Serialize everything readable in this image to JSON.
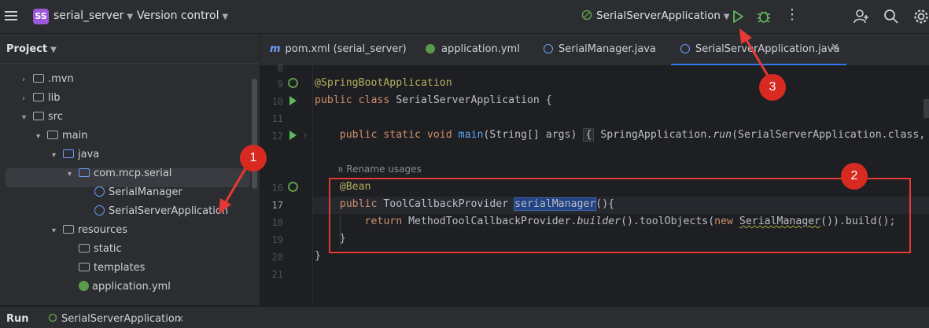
{
  "titlebar": {
    "project_badge": "SS",
    "project_name": "serial_server",
    "version_control": "Version control",
    "run_configuration": "SerialServerApplication",
    "more": "⋮"
  },
  "project_panel": {
    "title": "Project",
    "tree": [
      {
        "label": ".mvn",
        "kind": "folder",
        "depth": 1,
        "expanded": false
      },
      {
        "label": "lib",
        "kind": "folder",
        "depth": 1,
        "expanded": false
      },
      {
        "label": "src",
        "kind": "folder",
        "depth": 1,
        "expanded": true
      },
      {
        "label": "main",
        "kind": "folder",
        "depth": 2,
        "expanded": true
      },
      {
        "label": "java",
        "kind": "source-folder",
        "depth": 3,
        "expanded": true
      },
      {
        "label": "com.mcp.serial",
        "kind": "package",
        "depth": 4,
        "expanded": true
      },
      {
        "label": "SerialManager",
        "kind": "class",
        "depth": 5
      },
      {
        "label": "SerialServerApplication",
        "kind": "spring-class",
        "depth": 5,
        "selected": true
      },
      {
        "label": "resources",
        "kind": "resources-folder",
        "depth": 3,
        "expanded": true
      },
      {
        "label": "static",
        "kind": "folder",
        "depth": 4
      },
      {
        "label": "templates",
        "kind": "folder",
        "depth": 4
      },
      {
        "label": "application.yml",
        "kind": "yml",
        "depth": 4
      }
    ]
  },
  "tabs": [
    {
      "label": "pom.xml (serial_server)",
      "icon": "maven-icon"
    },
    {
      "label": "application.yml",
      "icon": "yml-icon"
    },
    {
      "label": "SerialManager.java",
      "icon": "class-icon"
    },
    {
      "label": "SerialServerApplication.java",
      "icon": "spring-class-icon",
      "active": true
    }
  ],
  "editor": {
    "line_numbers": [
      "8",
      "9",
      "10",
      "11",
      "12",
      "",
      "16",
      "17",
      "18",
      "19",
      "20",
      "21"
    ],
    "current_line": "17",
    "rename_hint": "Rename usages",
    "code": {
      "l9_annotation": "@SpringBootApplication",
      "l10_kw": "public class ",
      "l10_rest": "SerialServerApplication {",
      "l12_kw": "public static void ",
      "l12_fn": "main",
      "l12_args": "(String[] args) ",
      "l12_fold": "{",
      "l12_body1": " SpringApplication.",
      "l12_run": "run",
      "l12_body2": "(SerialServerApplication.class,",
      "l16_annotation": "@Bean",
      "l17_kw": "public ",
      "l17_type": "ToolCallbackProvider ",
      "l17_name": "serialManager",
      "l17_rest": "(){",
      "l18_kw": "return ",
      "l18_a": "MethodToolCallbackProvider.",
      "l18_builder": "builder",
      "l18_b": "().toolObjects(",
      "l18_new": "new ",
      "l18_cls": "SerialManager",
      "l18_c": "()).build();",
      "l19": "}",
      "l20": "}"
    }
  },
  "annotations": {
    "badges": [
      "1",
      "2",
      "3"
    ],
    "accent_color": "#d92a22"
  },
  "bottom": {
    "run_label": "Run",
    "run_config": "SerialServerApplication",
    "close": "×"
  },
  "colors": {
    "background": "#1e1f22",
    "panel": "#2b2d30",
    "keyword": "#cf8e6d",
    "annotation": "#b3ae60",
    "function": "#56a8f5",
    "selection": "#214283"
  }
}
